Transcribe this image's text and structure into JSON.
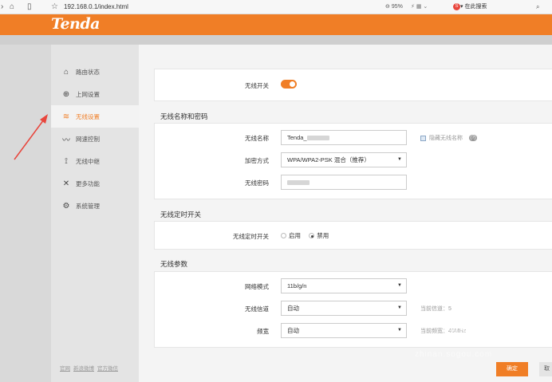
{
  "browser": {
    "url": "192.168.0.1/index.html",
    "zoom": "95%",
    "search_engine_label": "在此搜索"
  },
  "brand": {
    "logo": "Tenda"
  },
  "sidebar": {
    "items": [
      {
        "label": "路由状态",
        "icon": "router-icon"
      },
      {
        "label": "上网设置",
        "icon": "globe-icon"
      },
      {
        "label": "无线设置",
        "icon": "wifi-icon",
        "active": true
      },
      {
        "label": "网速控制",
        "icon": "speed-icon"
      },
      {
        "label": "无线中继",
        "icon": "antenna-icon"
      },
      {
        "label": "更多功能",
        "icon": "tools-icon"
      },
      {
        "label": "系统管理",
        "icon": "gear-icon"
      }
    ],
    "footer_links": [
      "官网",
      "新浪微博",
      "官方微信"
    ]
  },
  "wireless_switch": {
    "label": "无线开关",
    "on": true
  },
  "name_password": {
    "title": "无线名称和密码",
    "ssid_label": "无线名称",
    "ssid_value": "Tenda_",
    "hide_ssid_label": "隐藏无线名称",
    "help": "(?)",
    "encryption_label": "加密方式",
    "encryption_value": "WPA/WPA2-PSK 混合（推荐）",
    "password_label": "无线密码"
  },
  "schedule": {
    "title": "无线定时开关",
    "label": "无线定时开关",
    "enable": "启用",
    "disable": "禁用",
    "selected": "禁用"
  },
  "params": {
    "title": "无线参数",
    "mode_label": "网络模式",
    "mode_value": "11b/g/n",
    "channel_label": "无线信道",
    "channel_value": "自动",
    "current_channel": "当前信道：5",
    "bandwidth_label": "频宽",
    "bandwidth_value": "自动",
    "current_bandwidth": "当前频宽：40MHz"
  },
  "actions": {
    "ok": "确定",
    "cancel": "取"
  },
  "watermark": {
    "text": "搜狗指南",
    "url": "zhinan.sogou.com"
  },
  "colors": {
    "accent": "#f07e26",
    "annotation_arrow": "#e8453c"
  }
}
